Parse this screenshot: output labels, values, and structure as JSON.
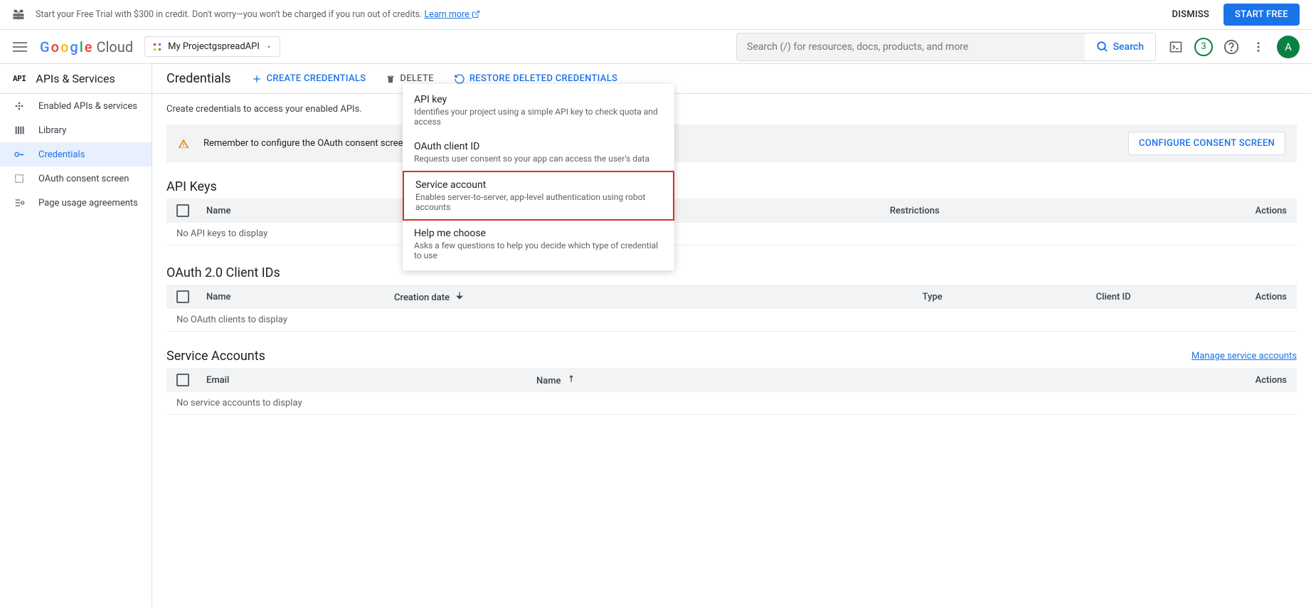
{
  "banner": {
    "text": "Start your Free Trial with $300 in credit. Don't worry—you won't be charged if you run out of credits. ",
    "learn_more": "Learn more",
    "dismiss": "DISMISS",
    "start_free": "START FREE"
  },
  "header": {
    "logo_cloud": "Cloud",
    "project_name": "My ProjectgspreadAPI",
    "search_placeholder": "Search (/) for resources, docs, products, and more",
    "search_btn": "Search",
    "badge_count": "3",
    "avatar_letter": "A"
  },
  "sidebar": {
    "section_title": "APIs & Services",
    "items": [
      {
        "label": "Enabled APIs & services"
      },
      {
        "label": "Library"
      },
      {
        "label": "Credentials"
      },
      {
        "label": "OAuth consent screen"
      },
      {
        "label": "Page usage agreements"
      }
    ]
  },
  "page": {
    "title": "Credentials",
    "create": "CREATE CREDENTIALS",
    "delete": "DELETE",
    "restore": "RESTORE DELETED CREDENTIALS",
    "subnote": "Create credentials to access your enabled APIs."
  },
  "alert": {
    "text": "Remember to configure the OAuth consent screen with information about your application.",
    "button": "CONFIGURE CONSENT SCREEN"
  },
  "dropdown": {
    "items": [
      {
        "title": "API key",
        "desc": "Identifies your project using a simple API key to check quota and access"
      },
      {
        "title": "OAuth client ID",
        "desc": "Requests user consent so your app can access the user's data"
      },
      {
        "title": "Service account",
        "desc": "Enables server-to-server, app-level authentication using robot accounts"
      },
      {
        "title": "Help me choose",
        "desc": "Asks a few questions to help you decide which type of credential to use"
      }
    ]
  },
  "sections": {
    "api_keys": {
      "title": "API Keys",
      "cols": {
        "name": "Name",
        "restrictions": "Restrictions",
        "actions": "Actions"
      },
      "empty": "No API keys to display"
    },
    "oauth": {
      "title": "OAuth 2.0 Client IDs",
      "cols": {
        "name": "Name",
        "creation": "Creation date",
        "type": "Type",
        "clientid": "Client ID",
        "actions": "Actions"
      },
      "empty": "No OAuth clients to display"
    },
    "service": {
      "title": "Service Accounts",
      "manage": "Manage service accounts",
      "cols": {
        "email": "Email",
        "name": "Name",
        "actions": "Actions"
      },
      "empty": "No service accounts to display"
    }
  }
}
